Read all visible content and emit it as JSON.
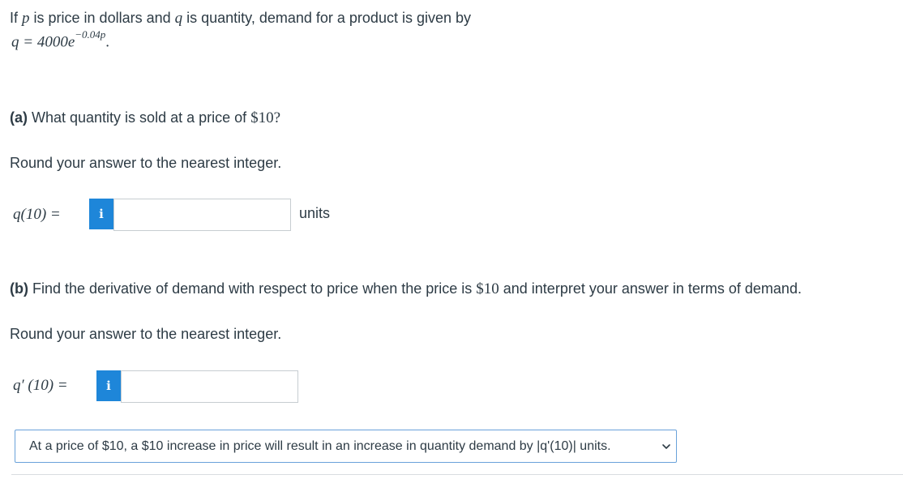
{
  "intro": {
    "prefix": "If ",
    "var_p": "p",
    "mid1": "is price in dollars and ",
    "var_q": "q",
    "mid2": "is quantity, demand for a product is given by",
    "equation_lhs": "q = 4000e",
    "equation_exp": "−0.04p",
    "equation_end": "."
  },
  "part_a": {
    "label": "(a)",
    "question_pre": " What quantity is sold at a price of ",
    "price": "$10?",
    "round_text": "Round your answer to the nearest integer.",
    "input_label": "q(10) =",
    "info_icon": "i",
    "answer_value": "",
    "units": "units"
  },
  "part_b": {
    "label": "(b)",
    "question_pre": " Find the derivative of demand with respect to price when the price is ",
    "price": "$10",
    "question_post": " and interpret your answer in terms of demand.",
    "round_text": "Round your answer to the nearest integer.",
    "input_label": "q′ (10) =",
    "info_icon": "i",
    "answer_value": "",
    "dropdown_selected": "At a price of $10, a $10 increase in price will result in an increase in quantity demand by |q'(10)| units."
  },
  "colors": {
    "accent": "#1e86d9",
    "text": "#2d3b45",
    "input_border": "#c7cdd1",
    "select_border": "#6aa2da"
  }
}
